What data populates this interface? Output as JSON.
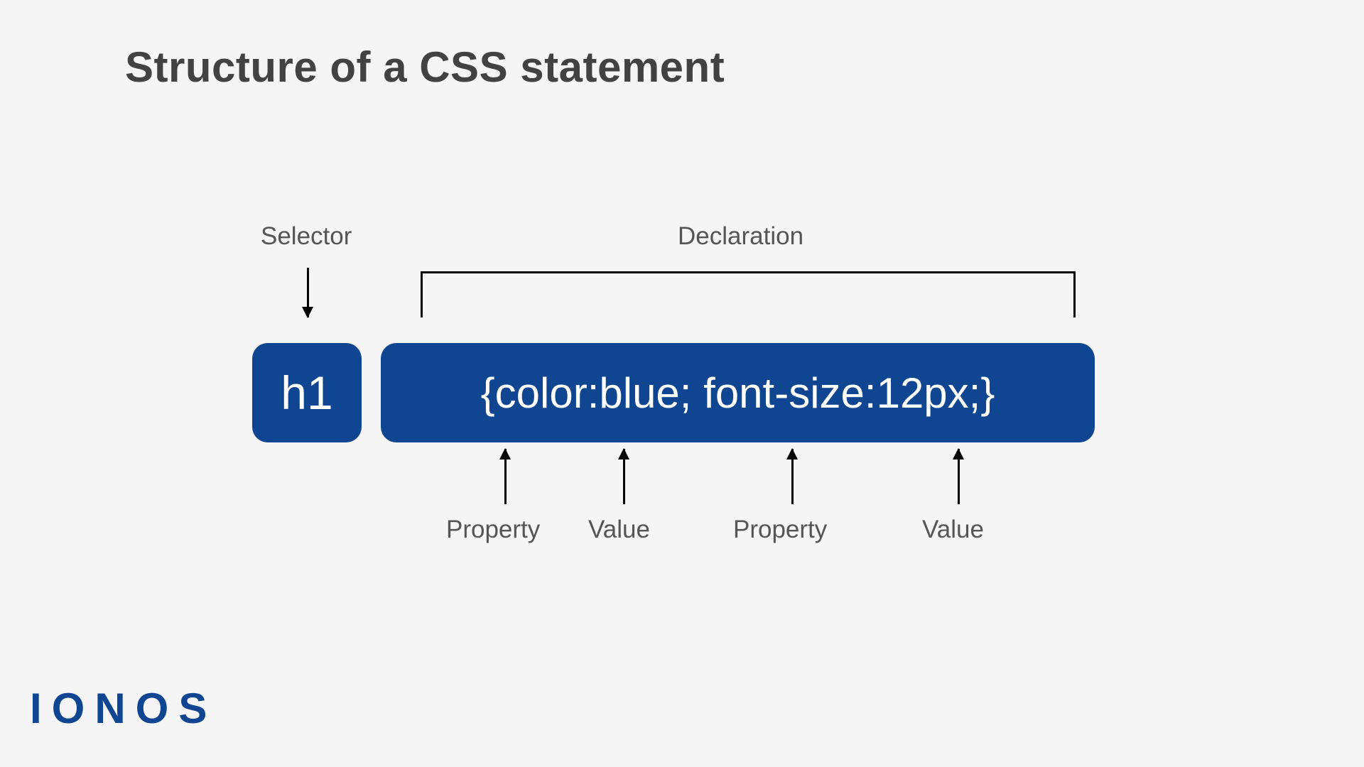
{
  "title": "Structure of a CSS statement",
  "labels": {
    "selector": "Selector",
    "declaration": "Declaration",
    "property1": "Property",
    "value1": "Value",
    "property2": "Property",
    "value2": "Value"
  },
  "boxes": {
    "selector_text": "h1",
    "declaration_text": "{color:blue; font-size:12px;}"
  },
  "logo": "IONOS",
  "colors": {
    "brand_blue": "#0f4591",
    "bg": "#f5f5f5",
    "title_grey": "#424242",
    "label_grey": "#555555"
  }
}
